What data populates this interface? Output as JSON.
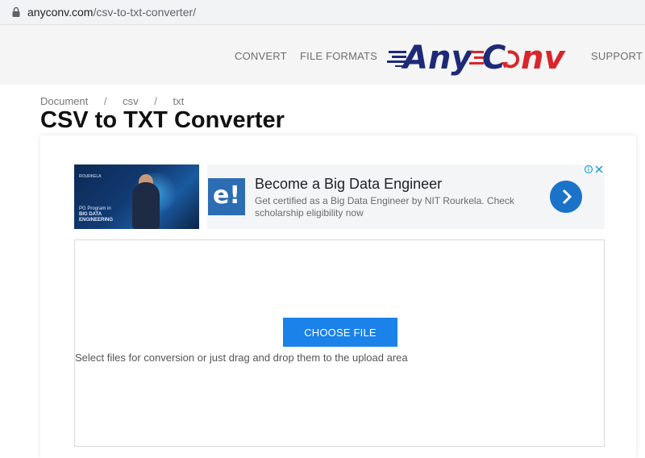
{
  "browser": {
    "url_domain": "anyconv.com",
    "url_path": "/csv-to-txt-converter/"
  },
  "header": {
    "nav": [
      "CONVERT",
      "FILE FORMATS",
      "SUPPORT"
    ],
    "logo_text_left": "Any",
    "logo_text_right": "nv",
    "logo_colors": {
      "navy": "#1e2a78",
      "red": "#d9262b"
    }
  },
  "breadcrumb": [
    "Document",
    "csv",
    "txt"
  ],
  "page_title": "CSV to TXT Converter",
  "ad": {
    "image_text": [
      "PG Program in",
      "BIG DATA",
      "ENGINEERING"
    ],
    "image_brand": "ROURKELA",
    "logo_text": "e!",
    "headline": "Become a Big Data Engineer",
    "description": "Get certified as a Big Data Engineer by NIT Rourkela. Check scholarship eligibility now"
  },
  "upload": {
    "button_label": "CHOOSE FILE",
    "hint": "Select files for conversion or just drag and drop them to the upload area",
    "button_color": "#1a82e8"
  }
}
